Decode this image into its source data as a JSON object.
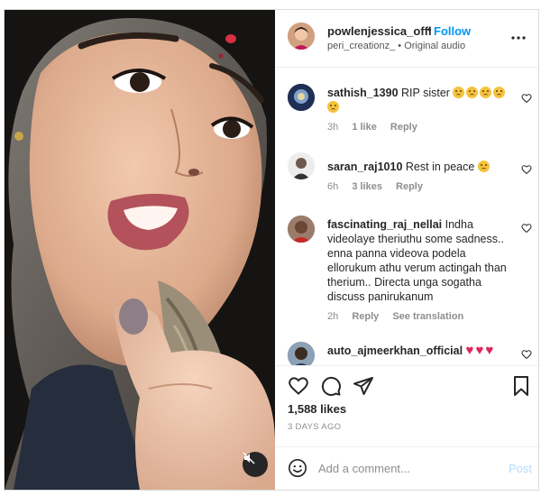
{
  "post": {
    "username": "powlenjessica_offl",
    "separator": "•",
    "follow_label": "Follow",
    "audio_user": "peri_creationz_",
    "audio_separator": "•",
    "audio_label": "Original audio",
    "more_icon": "more-horizontal-icon"
  },
  "comments": [
    {
      "username": "sathish_1390",
      "text": "RIP sister",
      "emoji_count": 5,
      "emoji_icon": "sad-face-emoji",
      "time": "3h",
      "likes": "1 like",
      "reply": "Reply",
      "avatar_color": "#2f3a5a"
    },
    {
      "username": "saran_raj1010",
      "text": "Rest in peace",
      "emoji_count": 1,
      "emoji_icon": "sad-face-emoji",
      "time": "6h",
      "likes": "3 likes",
      "reply": "Reply",
      "avatar_color": "#e8e8e8"
    },
    {
      "username": "fascinating_raj_nellai",
      "text": "Indha videolaye theriuthu some sadness.. enna panna videova podela ellorukum athu verum actingah than therium.. Directa unga sogatha discuss panirukanum",
      "time": "2h",
      "reply": "Reply",
      "translation": "See translation",
      "avatar_color": "#7a5c4e"
    },
    {
      "username": "auto_ajmeerkhan_official",
      "text": "",
      "heart_icon": "red-heart-emoji",
      "avatar_color": "#6f7f95"
    }
  ],
  "actions": {
    "like_icon": "heart-outline-icon",
    "comment_icon": "comment-icon",
    "share_icon": "paper-plane-icon",
    "save_icon": "bookmark-icon"
  },
  "likes_label": "1,588 likes",
  "date_label": "3 DAYS AGO",
  "add_comment": {
    "placeholder": "Add a comment...",
    "post_label": "Post",
    "emoji_icon": "smile-icon"
  },
  "media": {
    "mute_icon": "speaker-muted-icon"
  },
  "colors": {
    "link_blue": "#0095f6",
    "post_disabled": "#b3dbff",
    "meta_gray": "#8e8e8e",
    "text": "#262626"
  }
}
